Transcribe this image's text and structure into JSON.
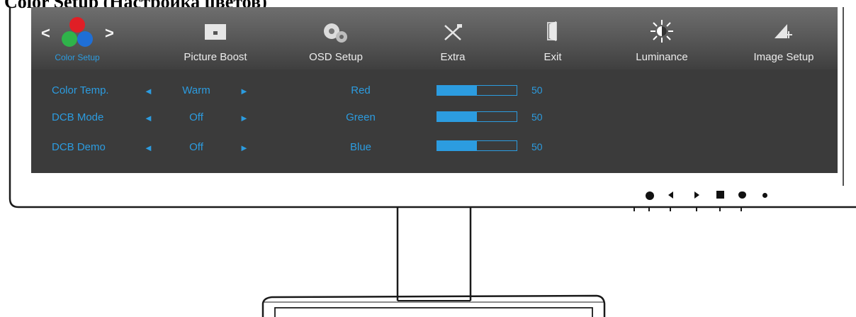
{
  "page": {
    "title": "Color Setup (Настройка цветов)"
  },
  "theme": {
    "accent": "#2c9ce0",
    "osd_bg": "#3b3b3b",
    "header_bg": "#5a5a5a",
    "tab_text": "#ececec"
  },
  "osd": {
    "nav_prev": "<",
    "nav_next": ">",
    "tabs": [
      {
        "label": "Color Setup",
        "icon": "rgb-circles-icon",
        "active": true
      },
      {
        "label": "Picture Boost",
        "icon": "picture-boost-icon",
        "active": false
      },
      {
        "label": "OSD Setup",
        "icon": "gears-icon",
        "active": false
      },
      {
        "label": "Extra",
        "icon": "tools-icon",
        "active": false
      },
      {
        "label": "Exit",
        "icon": "exit-door-icon",
        "active": false
      },
      {
        "label": "Luminance",
        "icon": "sun-icon",
        "active": false
      },
      {
        "label": "Image Setup",
        "icon": "image-setup-icon",
        "active": false
      }
    ],
    "settings": [
      {
        "label": "Color Temp.",
        "value": "Warm"
      },
      {
        "label": "DCB Mode",
        "value": "Off"
      },
      {
        "label": "DCB Demo",
        "value": "Off"
      }
    ],
    "arrow_left": "◄",
    "arrow_right": "►",
    "channels": [
      {
        "label": "Red",
        "value": 50,
        "value_text": "50"
      },
      {
        "label": "Green",
        "value": 50,
        "value_text": "50"
      },
      {
        "label": "Blue",
        "value": 50,
        "value_text": "50"
      }
    ]
  },
  "buttons": [
    {
      "icon": "power-button-icon"
    },
    {
      "icon": "left-button-icon"
    },
    {
      "icon": "right-button-icon"
    },
    {
      "icon": "menu-button-icon"
    },
    {
      "icon": "source-button-icon"
    },
    {
      "icon": "power-led-icon"
    }
  ]
}
